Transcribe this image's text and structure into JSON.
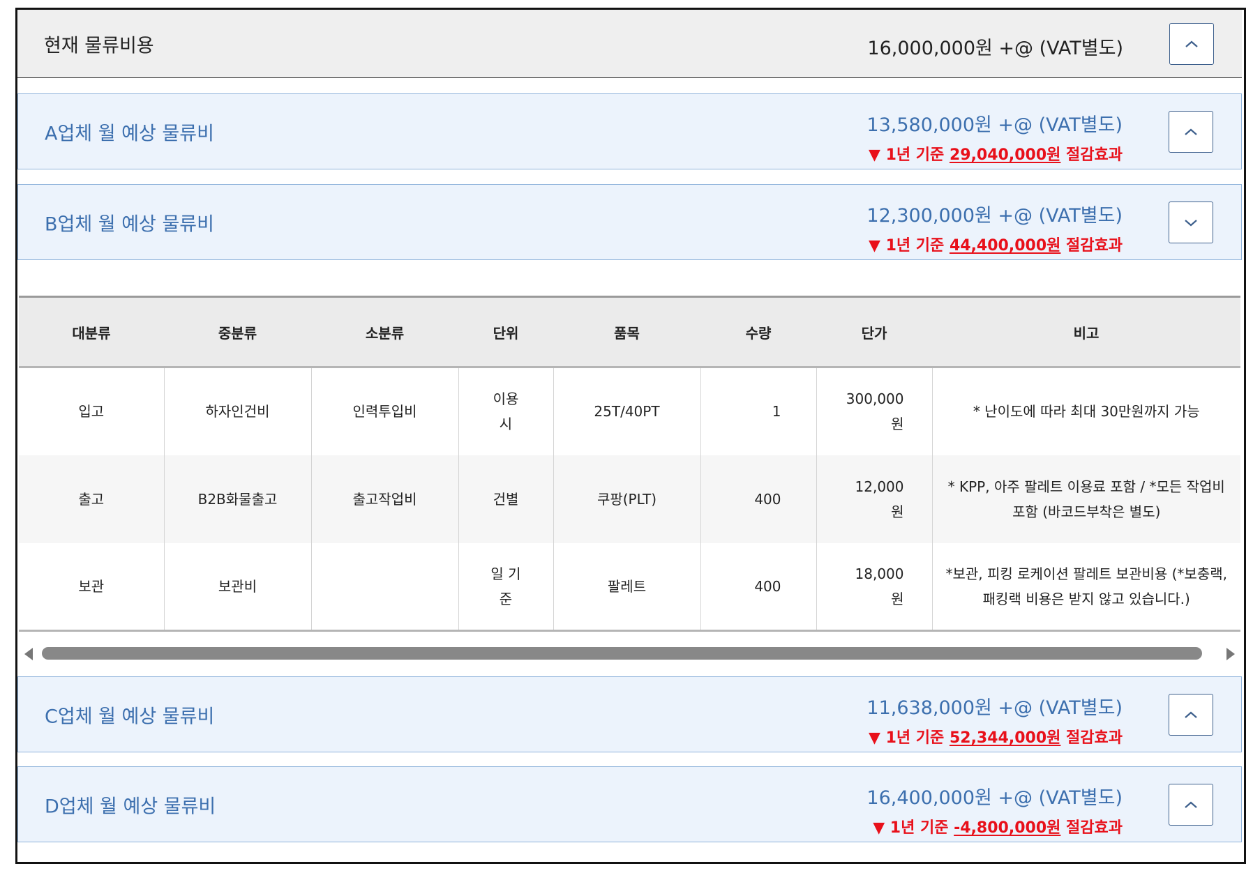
{
  "current": {
    "title": "현재 물류비용",
    "price": "16,000,000원 +@ (VAT별도)"
  },
  "vendors": [
    {
      "title": "A업체 월 예상 물류비",
      "price": "13,580,000원 +@ (VAT별도)",
      "saving_prefix": "▼ 1년 기준 ",
      "saving_amount": "29,040,000원",
      "saving_suffix": " 절감효과",
      "toggle_icon": "chevron-up-icon"
    },
    {
      "title": "B업체 월 예상 물류비",
      "price": "12,300,000원 +@ (VAT별도)",
      "saving_prefix": "▼ 1년 기준 ",
      "saving_amount": "44,400,000원",
      "saving_suffix": " 절감효과",
      "toggle_icon": "chevron-down-icon"
    },
    {
      "title": "C업체 월 예상 물류비",
      "price": "11,638,000원 +@ (VAT별도)",
      "saving_prefix": "▼ 1년 기준 ",
      "saving_amount": "52,344,000원",
      "saving_suffix": " 절감효과",
      "toggle_icon": "chevron-up-icon"
    },
    {
      "title": "D업체 월 예상 물류비",
      "price": "16,400,000원 +@ (VAT별도)",
      "saving_prefix": "▼ 1년 기준 ",
      "saving_amount": "-4,800,000원",
      "saving_suffix": " 절감효과",
      "toggle_icon": "chevron-up-icon"
    }
  ],
  "table": {
    "headers": [
      "대분류",
      "중분류",
      "소분류",
      "단위",
      "품목",
      "수량",
      "단가",
      "비고"
    ],
    "rows": [
      [
        "입고",
        "하자인건비",
        "인력투입비",
        "이용시",
        "25T/40PT",
        "1",
        "300,000원",
        "* 난이도에 따라 최대 30만원까지 가능"
      ],
      [
        "출고",
        "B2B화물출고",
        "출고작업비",
        "건별",
        "쿠팡(PLT)",
        "400",
        "12,000원",
        "* KPP, 아주 팔레트 이용료 포함 / *모든 작업비 포함 (바코드부착은 별도)"
      ],
      [
        "보관",
        "보관비",
        "",
        "일 기준",
        "팔레트",
        "400",
        "18,000원",
        "*보관, 피킹 로케이션 팔레트 보관비용 (*보충랙, 패킹랙 비용은 받지 않고 있습니다.)"
      ]
    ]
  },
  "colors": {
    "accent_blue": "#3c6fae",
    "panel_bg": "#ecf3fc",
    "panel_border": "#8fb3db",
    "saving_red": "#e8101a",
    "header_gray": "#efefef"
  }
}
